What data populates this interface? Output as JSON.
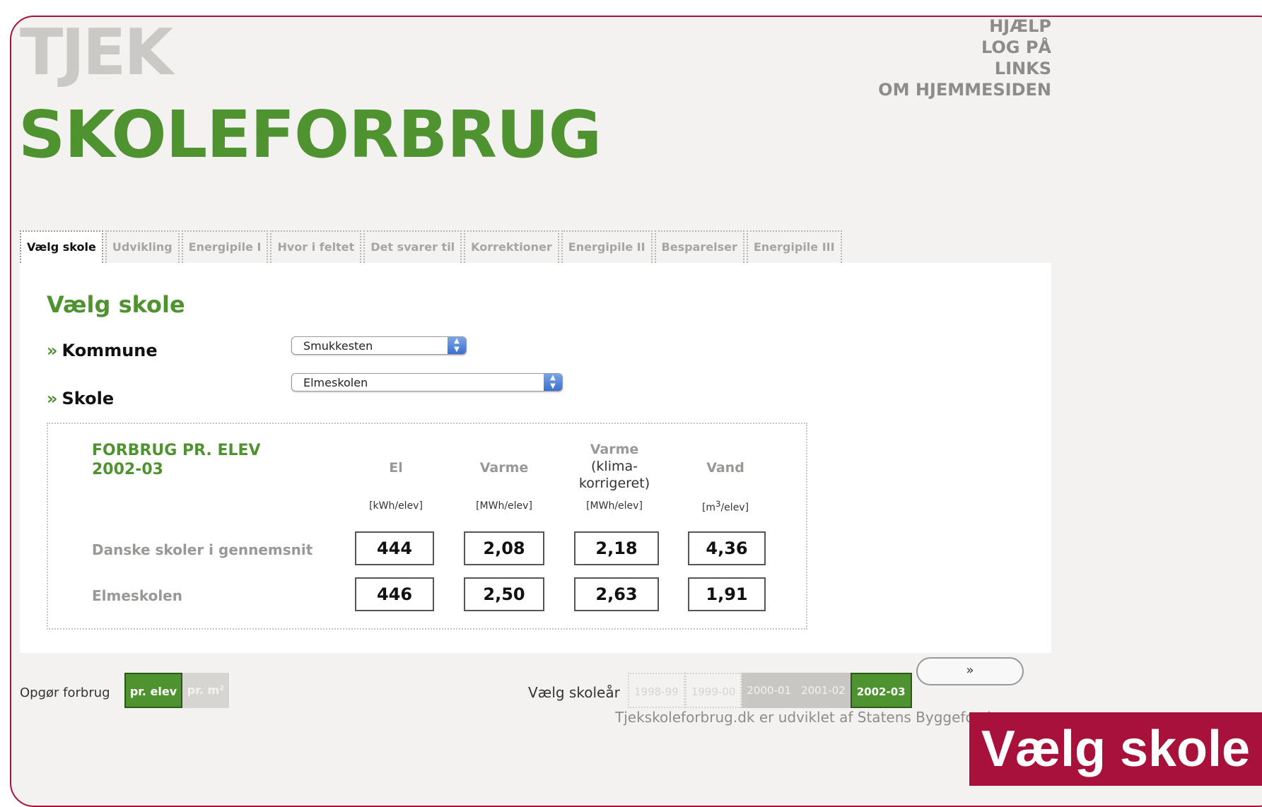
{
  "logo": {
    "line1": "TJEK",
    "line2": "SKOLEFORBRUG"
  },
  "topnav": [
    "HJÆLP",
    "LOG PÅ",
    "LINKS",
    "OM HJEMMESIDEN"
  ],
  "tabs": [
    "Vælg skole",
    "Udvikling",
    "Energipile I",
    "Hvor i feltet",
    "Det svarer til",
    "Korrektioner",
    "Energipile II",
    "Besparelser",
    "Energipile III"
  ],
  "panel": {
    "title": "Vælg skole",
    "kommune_label": "Kommune",
    "skole_label": "Skole",
    "kommune_value": "Smukkesten",
    "skole_value": "Elmeskolen",
    "chevron": "»"
  },
  "consumption": {
    "title_line1": "FORBRUG PR. ELEV",
    "title_line2": "2002-03",
    "columns": [
      {
        "head": "El",
        "unit": "[kWh/elev]"
      },
      {
        "head": "Varme",
        "unit": "[MWh/elev]"
      },
      {
        "head": "Varme",
        "head2": "(klima-",
        "head3": "korrigeret)",
        "unit": "[MWh/elev]"
      },
      {
        "head": "Vand",
        "unit_pre": "[m",
        "unit_sup": "3",
        "unit_post": "/elev]"
      }
    ],
    "rows": [
      {
        "label": "Danske skoler i gennemsnit",
        "values": [
          "444",
          "2,08",
          "2,18",
          "4,36"
        ]
      },
      {
        "label": "Elmeskolen",
        "values": [
          "446",
          "2,50",
          "2,63",
          "1,91"
        ]
      }
    ]
  },
  "bottom": {
    "opgor_label": "Opgør forbrug",
    "toggle_on": "pr. elev",
    "toggle_off": "pr. m²",
    "year_label": "Vælg skoleår",
    "years": [
      "1998-99",
      "1999-00",
      "2000-01",
      "2001-02",
      "2002-03"
    ],
    "selected_year": "2002-03",
    "next_label": "»",
    "footer": "Tjekskoleforbrug.dk er udviklet af Statens Byggeforskn"
  },
  "badge": "Vælg skole",
  "colors": {
    "green": "#4f9330",
    "crimson": "#a8123a",
    "grey": "#9a9895"
  }
}
